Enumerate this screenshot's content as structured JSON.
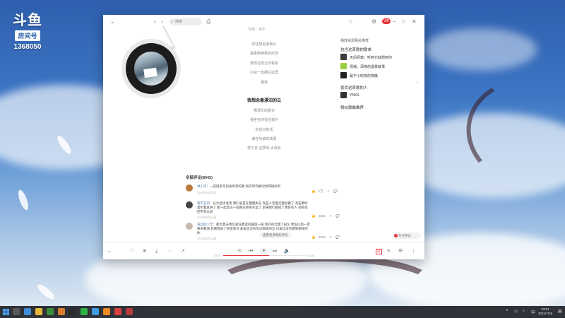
{
  "overlay": {
    "brand": "斗鱼",
    "room_label": "房间号",
    "room_number": "1368050"
  },
  "window": {
    "search": {
      "placeholder": "搜索"
    },
    "vip_badge": "VIP",
    "song_meta": "专辑：歌手"
  },
  "lyrics": {
    "lines": [
      "你还想看看我么",
      "温柔眼神我多欣赏",
      "我现在想让你看看",
      "只会一直都在这里",
      "相逢",
      "",
      "我想念着漂泊的云",
      "那漫长的夏日",
      "我坐在你背后窗外",
      "你说过的话",
      "谁在听谁的故事",
      "等下去 这季风 太漫长"
    ],
    "current_index": 6
  },
  "right_panel": {
    "tabs": [
      "播放来源",
      "相关推荐"
    ],
    "section1_title": "包含这首歌的歌单",
    "playlists": [
      {
        "name": "天后经典：听到它就想到你",
        "color": "#3c3c3c"
      },
      {
        "name": "情绪：深夜的温柔故事",
        "color": "#9ccf3f"
      },
      {
        "name": "属于小时候的夜晚",
        "color": "#222222"
      }
    ],
    "section2_title": "喜欢这首歌的人",
    "likers": [
      {
        "name": "YNKS",
        "color": "#333333"
      }
    ],
    "section3_title": "相似歌曲推荐"
  },
  "comments": {
    "title": "全部评论(8042)",
    "items": [
      {
        "user": "林小白",
        "text": "一首很多年前会听到的歌 再次听到依旧觉得很好听",
        "time": "2019年11月3日",
        "likes": "1万",
        "avatar_color": "#b87a3a"
      },
      {
        "user": "我不是风",
        "text": "长大后才发现 我们总是在慢慢失去 有些人走着走着就散了 有些歌听着听着就哭了 能一起走过一段路已经很幸运了 后来我们都成了更好的人 却再也回不到从前",
        "time": "2020年5月20日",
        "likes": "4025",
        "avatar_color": "#444444"
      },
      {
        "user": "海边的少年",
        "text": "那年夏天我们坐在教室的最后一排 窗外的云飘了很久 你说以后一定要去看海 后来我去了很多地方 却再也没有见过那样的云 也再也没有遇到那样的你",
        "time": "2021年2月14日",
        "likes": "2233",
        "avatar_color": "#c9b8b0"
      }
    ],
    "related_tag": "查看更多精彩评论",
    "write_placeholder": "写点评论"
  },
  "player": {
    "time_current": "02:31",
    "time_total": "04:28",
    "progress": 0.56,
    "lyrics_label": "词"
  },
  "taskbar": {
    "time": "23:01",
    "date": "2021/7/16"
  }
}
